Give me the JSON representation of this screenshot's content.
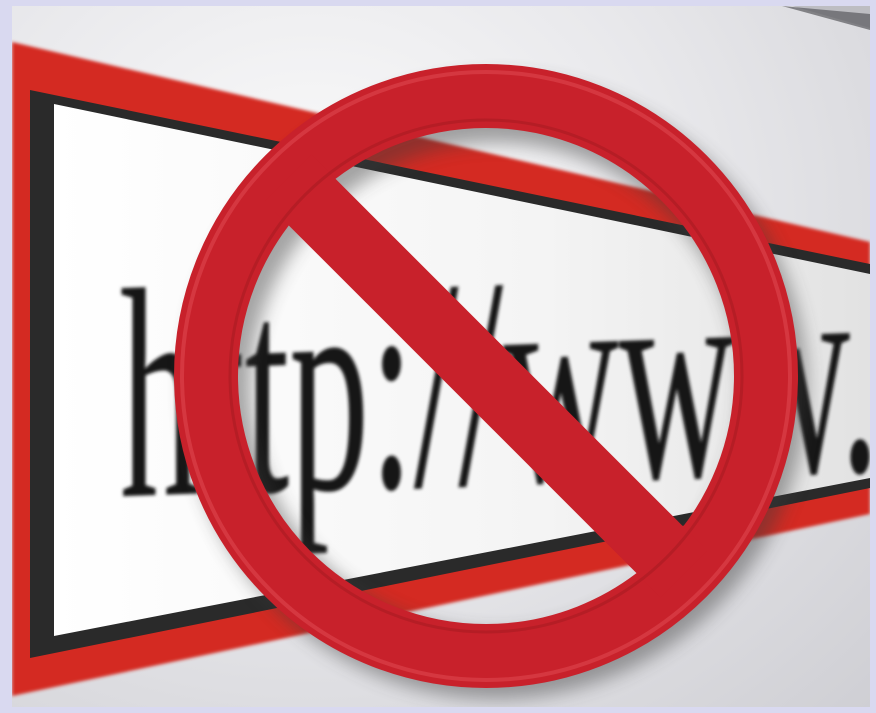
{
  "image": {
    "url_text": "http://www.",
    "symbol": "prohibition-sign",
    "colors": {
      "frame_background": "#d9d9f0",
      "address_bar_border": "#d42a22",
      "prohibition_sign": "#c8212b",
      "url_text": "#141414"
    }
  }
}
